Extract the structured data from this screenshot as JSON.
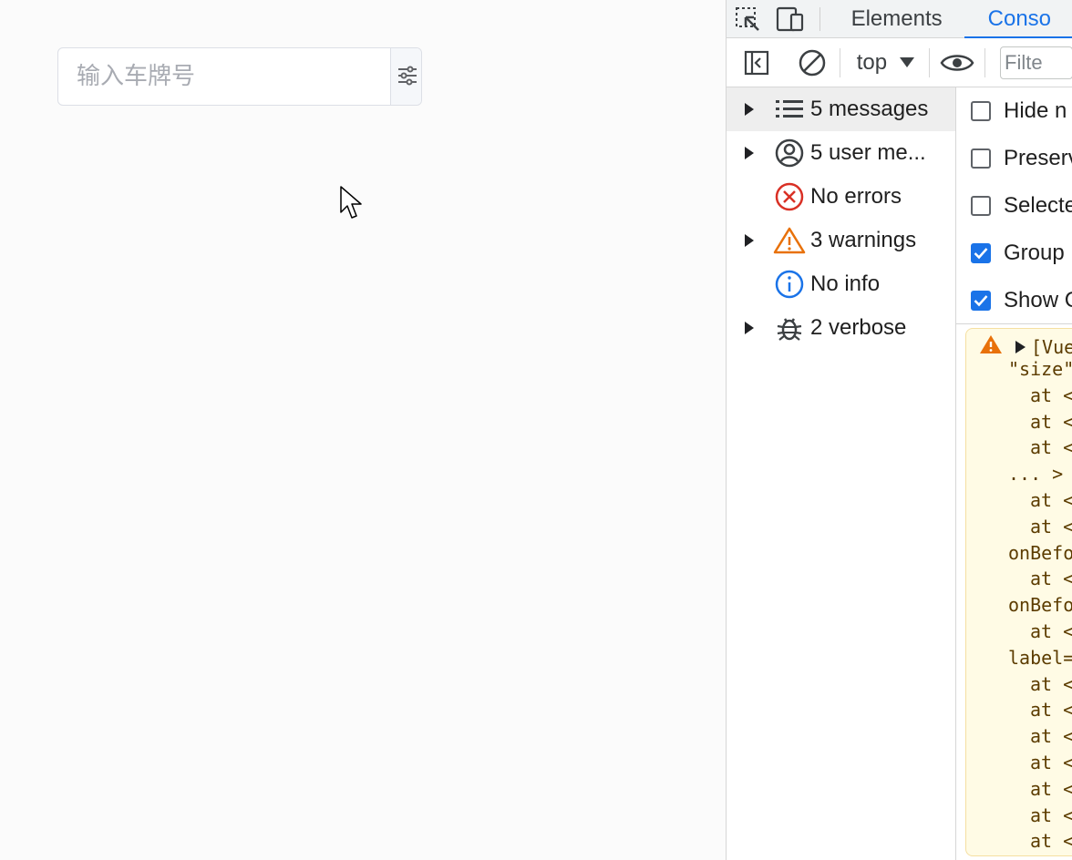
{
  "page": {
    "search": {
      "placeholder": "输入车牌号",
      "filter_icon": "sliders-icon"
    }
  },
  "devtools": {
    "tabs": [
      {
        "label": "Elements"
      },
      {
        "label": "Conso"
      }
    ],
    "toolbar": {
      "context": "top",
      "filter_placeholder": "Filte"
    },
    "sidebar": {
      "items": [
        {
          "label": "5 messages",
          "icon": "list-icon"
        },
        {
          "label": "5 user me...",
          "icon": "user-icon"
        },
        {
          "label": "No errors",
          "icon": "error-icon"
        },
        {
          "label": "3 warnings",
          "icon": "warning-icon"
        },
        {
          "label": "No info",
          "icon": "info-icon"
        },
        {
          "label": "2 verbose",
          "icon": "bug-icon"
        }
      ]
    },
    "settings": [
      {
        "label": "Hide n",
        "checked": false
      },
      {
        "label": "Preserv",
        "checked": false
      },
      {
        "label": "Selecte",
        "checked": false
      },
      {
        "label": "Group",
        "checked": true
      },
      {
        "label": "Show C",
        "checked": true
      }
    ],
    "console": {
      "warning_head": "[Vue",
      "lines": [
        "\"size\"",
        "at <",
        "at <",
        "at <",
        "... >",
        "at <",
        "at <",
        "onBefo",
        "at <",
        "onBefo",
        "at <",
        "label=",
        "at <",
        "at <",
        "at <",
        "at <",
        "at <",
        "at <",
        "at <"
      ]
    },
    "colors": {
      "accent": "#1a73e8",
      "warning_bg": "#fffbe5",
      "error": "#d93025",
      "warning": "#e8710a"
    }
  }
}
